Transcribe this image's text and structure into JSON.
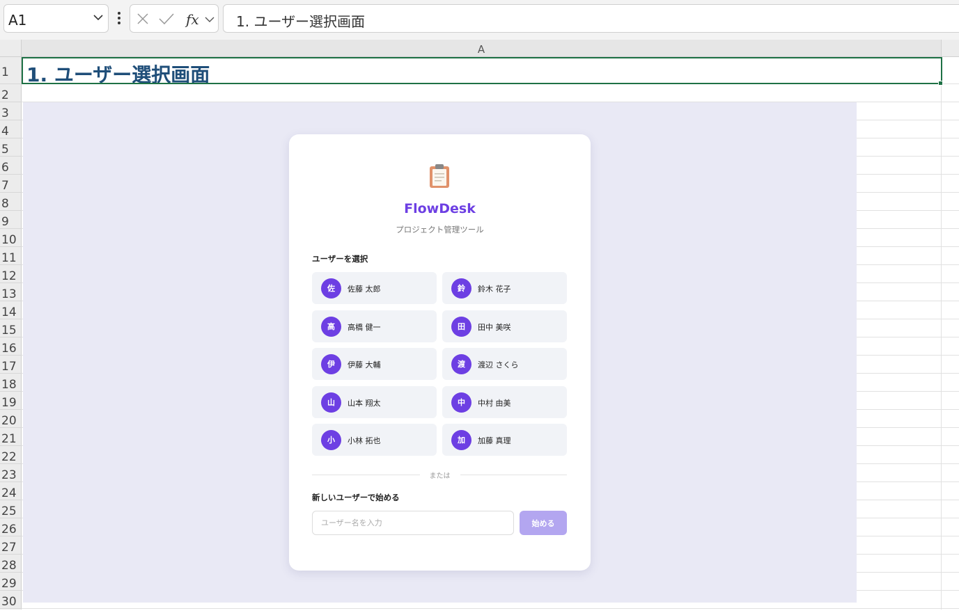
{
  "formula_bar": {
    "name_box": "A1",
    "formula": "1. ユーザー選択画面"
  },
  "sheet": {
    "column_header": "A",
    "row_numbers": [
      "1",
      "2",
      "3",
      "4",
      "5",
      "6",
      "7",
      "8",
      "9",
      "10",
      "11",
      "12",
      "13",
      "14",
      "15",
      "16",
      "17",
      "18",
      "19",
      "20",
      "21",
      "22",
      "23",
      "24",
      "25",
      "26",
      "27",
      "28",
      "29",
      "30"
    ],
    "a1_text": "1. ユーザー選択画面",
    "selection_color": "#1e7145"
  },
  "app": {
    "brand": "FlowDesk",
    "tagline": "プロジェクト管理ツール",
    "logo_icon": "clipboard-icon",
    "select_title": "ユーザーを選択",
    "users": [
      {
        "initial": "佐",
        "name": "佐藤 太郎"
      },
      {
        "initial": "鈴",
        "name": "鈴木 花子"
      },
      {
        "initial": "高",
        "name": "高橋 健一"
      },
      {
        "initial": "田",
        "name": "田中 美咲"
      },
      {
        "initial": "伊",
        "name": "伊藤 大輔"
      },
      {
        "initial": "渡",
        "name": "渡辺 さくら"
      },
      {
        "initial": "山",
        "name": "山本 翔太"
      },
      {
        "initial": "中",
        "name": "中村 由美"
      },
      {
        "initial": "小",
        "name": "小林 拓也"
      },
      {
        "initial": "加",
        "name": "加藤 真理"
      }
    ],
    "or_text": "または",
    "new_user_title": "新しいユーザーで始める",
    "input_placeholder": "ユーザー名を入力",
    "start_label": "始める",
    "accent_color": "#6d3fe3"
  }
}
